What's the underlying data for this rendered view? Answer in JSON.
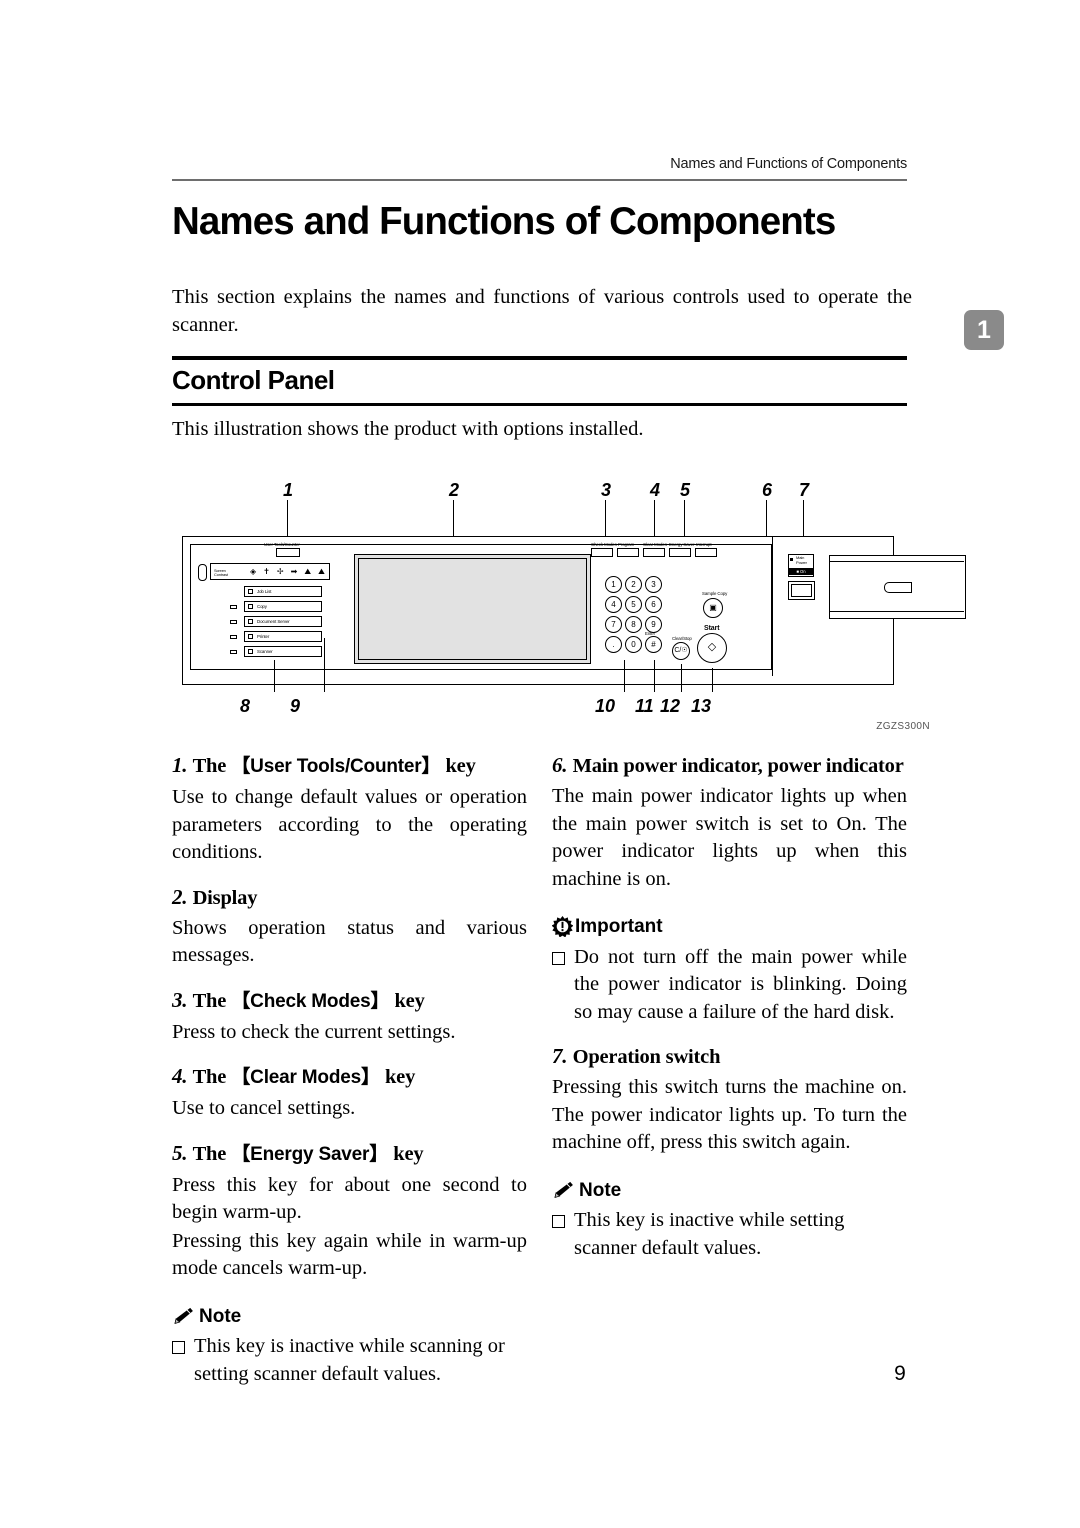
{
  "header": {
    "running_title": "Names and Functions of Components"
  },
  "chapter_tab": {
    "number": "1"
  },
  "page": {
    "title": "Names and Functions of Components",
    "intro": "This section explains the names and functions of various controls used to operate the scanner.",
    "number": "9"
  },
  "section": {
    "heading": "Control Panel",
    "subintro": "This illustration shows the product with options installed."
  },
  "figure": {
    "id": "ZGZS300N",
    "callouts_top": [
      "1",
      "2",
      "3",
      "4",
      "5",
      "6",
      "7"
    ],
    "callouts_bottom": [
      "8",
      "9",
      "10",
      "11",
      "12",
      "13"
    ],
    "panel_labels": {
      "user_tools_counter": "User Tools/Counter",
      "screen_contrast": "Screen Contrast",
      "job_list": "Job List",
      "copy": "Copy",
      "document_server": "Document Server",
      "printer": "Printer",
      "scanner": "Scanner",
      "check_modes": "Check Modes",
      "program": "Program",
      "clear_modes": "Clear Modes",
      "energy_saver": "Energy Saver",
      "interrupt": "Interrupt",
      "sample_copy": "Sample Copy",
      "start": "Start",
      "clear_stop": "Clear/Stop",
      "hash": "#",
      "main_power": "Main Power",
      "on": "On"
    },
    "keypad": [
      "1",
      "2",
      "3",
      "4",
      "5",
      "6",
      "7",
      "8",
      "9",
      ".",
      "0",
      "#"
    ]
  },
  "items": {
    "left": [
      {
        "num": "1.",
        "pre": "The",
        "key": "【User Tools/Counter】",
        "post": "key",
        "body": [
          "Use to change default values or operation parameters according to the operating conditions."
        ]
      },
      {
        "num": "2.",
        "plain_head": "Display",
        "body": [
          "Shows operation status and various messages."
        ]
      },
      {
        "num": "3.",
        "pre": "The",
        "key": "【Check Modes】",
        "post": "key",
        "body": [
          "Press to check the current settings."
        ]
      },
      {
        "num": "4.",
        "pre": "The",
        "key": "【Clear Modes】",
        "post": "key",
        "body": [
          "Use to cancel settings."
        ]
      },
      {
        "num": "5.",
        "pre": "The",
        "key": "【Energy Saver】",
        "post": "key",
        "body": [
          "Press this key for about one second to begin warm-up.",
          "Pressing this key again while in warm-up mode cancels warm-up."
        ]
      }
    ],
    "left_note": {
      "label": "Note",
      "bullets": [
        "This key is inactive while scanning or setting scanner default values."
      ]
    },
    "right": [
      {
        "num": "6.",
        "plain_head": "Main power indicator, power indicator",
        "body": [
          "The main power indicator lights up when the main power switch is set to On. The power indicator lights up when this machine is on."
        ]
      }
    ],
    "right_important": {
      "label": "Important",
      "bullets": [
        "Do not turn off the main power while the power indicator is blinking. Doing so may cause a failure of the hard disk."
      ]
    },
    "right_2": [
      {
        "num": "7.",
        "plain_head": "Operation switch",
        "body": [
          "Pressing this switch turns the machine on. The power indicator lights up. To turn the machine off, press this switch again."
        ]
      }
    ],
    "right_note": {
      "label": "Note",
      "bullets": [
        "This key is inactive while setting scanner default values."
      ]
    }
  }
}
